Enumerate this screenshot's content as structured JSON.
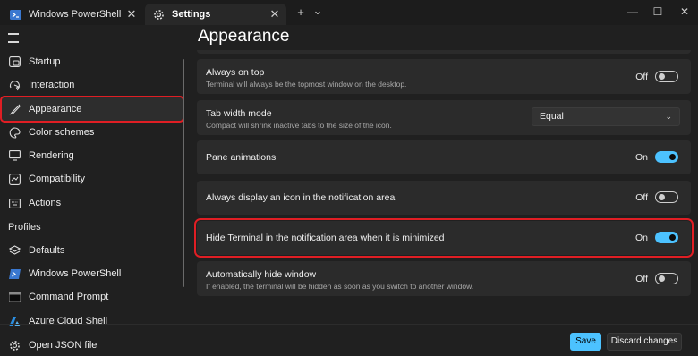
{
  "tabs": [
    {
      "label": "Windows PowerShell",
      "icon": "powershell-icon"
    },
    {
      "label": "Settings",
      "icon": "gear-icon"
    }
  ],
  "titlebar": {
    "new_tab": "+",
    "dropdown": "⌄",
    "minimize": "—",
    "maximize": "☐",
    "close": "✕"
  },
  "sidebar": {
    "items": [
      {
        "label": "Startup",
        "icon": "startup-icon"
      },
      {
        "label": "Interaction",
        "icon": "interaction-icon"
      },
      {
        "label": "Appearance",
        "icon": "brush-icon",
        "selected": true
      },
      {
        "label": "Color schemes",
        "icon": "palette-icon"
      },
      {
        "label": "Rendering",
        "icon": "monitor-icon"
      },
      {
        "label": "Compatibility",
        "icon": "compatibility-icon"
      },
      {
        "label": "Actions",
        "icon": "keyboard-icon"
      }
    ],
    "profiles_label": "Profiles",
    "profiles": [
      {
        "label": "Defaults",
        "icon": "layers-icon"
      },
      {
        "label": "Windows PowerShell",
        "icon": "powershell-icon"
      },
      {
        "label": "Command Prompt",
        "icon": "cmd-icon"
      },
      {
        "label": "Azure Cloud Shell",
        "icon": "azure-icon"
      }
    ],
    "open_json": {
      "label": "Open JSON file",
      "icon": "gear-icon"
    }
  },
  "main": {
    "title": "Appearance",
    "settings": [
      {
        "label": "Always on top",
        "desc": "Terminal will always be the topmost window on the desktop.",
        "state": "Off"
      },
      {
        "label": "Tab width mode",
        "desc": "Compact will shrink inactive tabs to the size of the icon.",
        "value": "Equal"
      },
      {
        "label": "Pane animations",
        "state": "On"
      },
      {
        "label": "Always display an icon in the notification area",
        "state": "Off"
      },
      {
        "label": "Hide Terminal in the notification area when it is minimized",
        "state": "On",
        "highlighted": true
      },
      {
        "label": "Automatically hide window",
        "desc": "If enabled, the terminal will be hidden as soon as you switch to another window.",
        "state": "Off"
      }
    ]
  },
  "footer": {
    "save": "Save",
    "discard": "Discard changes"
  },
  "colors": {
    "accent": "#4cc2ff",
    "highlight": "#e01e24",
    "background": "#202020",
    "card": "#2b2b2b"
  }
}
